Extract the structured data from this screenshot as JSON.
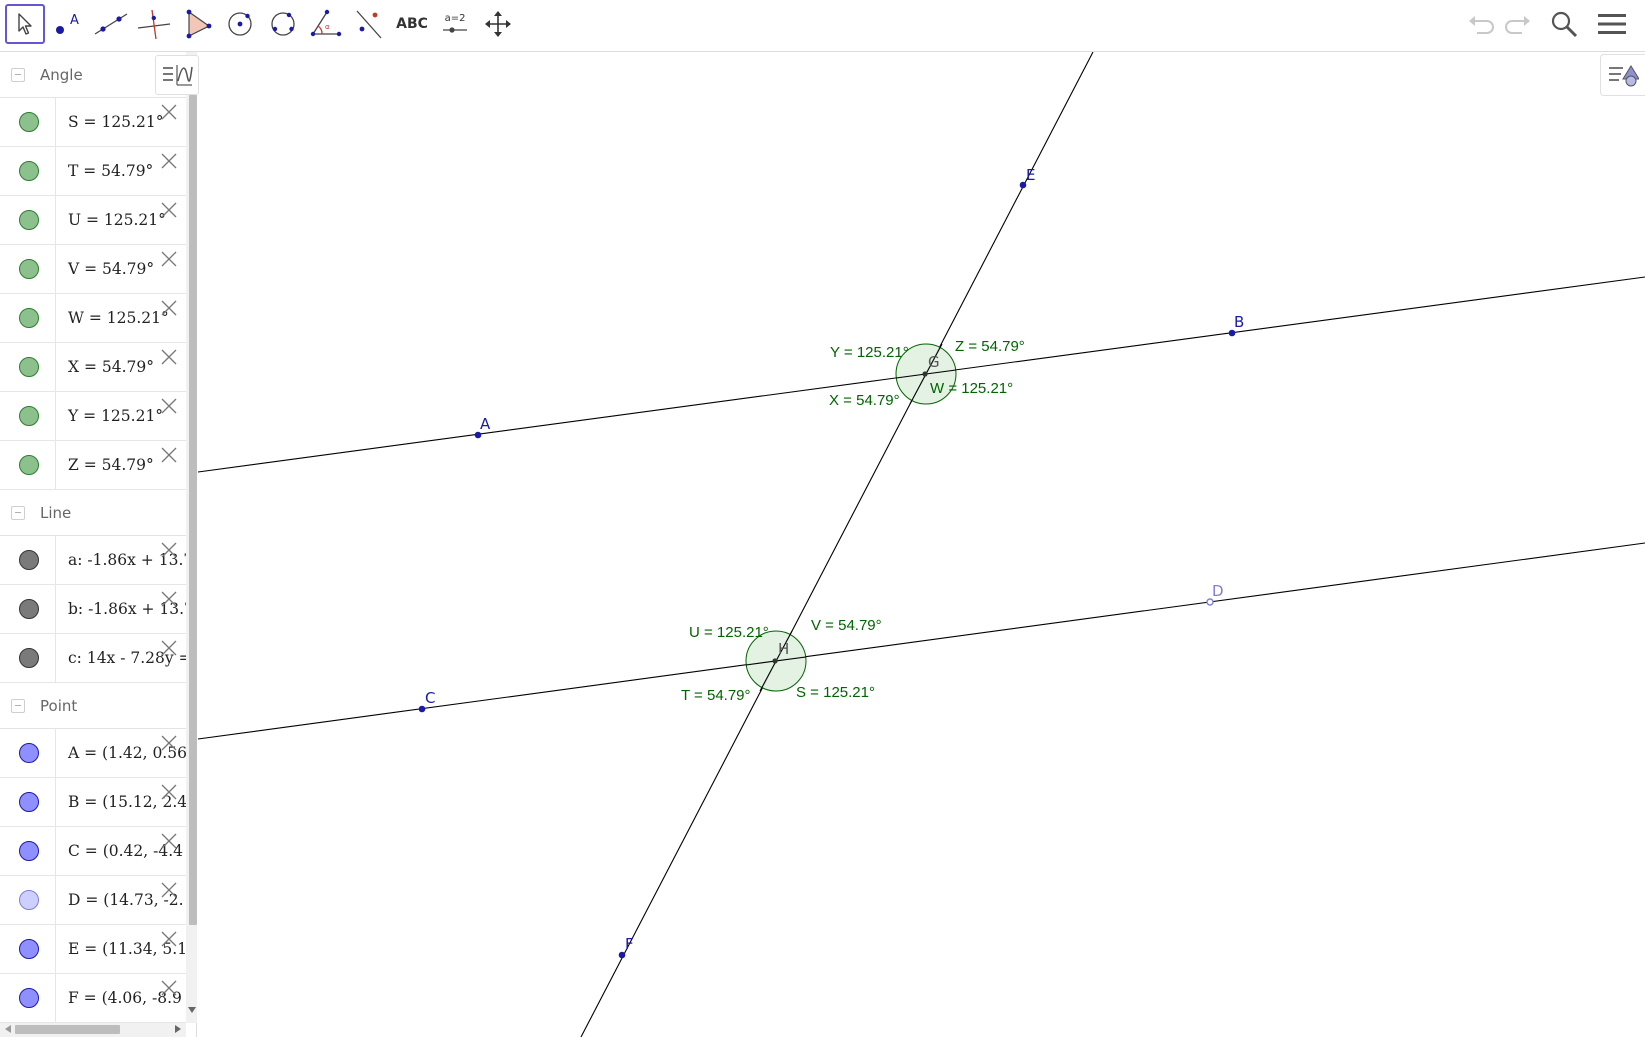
{
  "toolbar": {
    "tools": [
      {
        "name": "move-tool",
        "active": true
      },
      {
        "name": "point-tool",
        "label": "A"
      },
      {
        "name": "line-tool"
      },
      {
        "name": "perpendicular-line-tool"
      },
      {
        "name": "polygon-tool"
      },
      {
        "name": "circle-center-point-tool"
      },
      {
        "name": "circle-three-points-tool"
      },
      {
        "name": "angle-tool"
      },
      {
        "name": "reflect-about-line-tool"
      },
      {
        "name": "text-tool",
        "label": "ABC"
      },
      {
        "name": "slider-tool",
        "label": "a=2"
      },
      {
        "name": "move-graphics-view-tool"
      }
    ],
    "right_icons": [
      "undo-icon",
      "redo-icon",
      "search-icon",
      "menu-icon"
    ]
  },
  "algebra": {
    "groups": [
      {
        "title": "Angle",
        "items": [
          {
            "text": "S = 125.21°",
            "color": "#8cc08c"
          },
          {
            "text": "T = 54.79°",
            "color": "#8cc08c"
          },
          {
            "text": "U = 125.21°",
            "color": "#8cc08c"
          },
          {
            "text": "V = 54.79°",
            "color": "#8cc08c"
          },
          {
            "text": "W = 125.21°",
            "color": "#8cc08c"
          },
          {
            "text": "X = 54.79°",
            "color": "#8cc08c"
          },
          {
            "text": "Y = 125.21°",
            "color": "#8cc08c"
          },
          {
            "text": "Z = 54.79°",
            "color": "#8cc08c"
          }
        ]
      },
      {
        "title": "Line",
        "items": [
          {
            "text": "a: -1.86x + 13.7",
            "color": "#7a7a7a"
          },
          {
            "text": "b: -1.86x + 13.7",
            "color": "#7a7a7a"
          },
          {
            "text": "c: 14x - 7.28y =",
            "color": "#7a7a7a"
          }
        ]
      },
      {
        "title": "Point",
        "items": [
          {
            "text": "A = (1.42, 0.56",
            "color": "#8f8fff"
          },
          {
            "text": "B = (15.12, 2.4",
            "color": "#8f8fff"
          },
          {
            "text": "C = (0.42, -4.4",
            "color": "#8f8fff"
          },
          {
            "text": "D = (14.73, -2.",
            "color": "#cccfff"
          },
          {
            "text": "E = (11.34, 5.1",
            "color": "#8f8fff"
          },
          {
            "text": "F = (4.06, -8.9",
            "color": "#8f8fff"
          }
        ]
      }
    ]
  },
  "graphics": {
    "colors": {
      "point": "#1a1aa8",
      "point_light": "#7f7fd6",
      "angle": "#006400",
      "angle_fill": "#dff0df",
      "line": "#000000"
    },
    "points": {
      "A": "A",
      "B": "B",
      "C": "C",
      "D": "D",
      "E": "E",
      "F": "F",
      "G": "G",
      "H": "H"
    },
    "angle_labels": {
      "S": "S = 125.21°",
      "T": "T = 54.79°",
      "U": "U = 125.21°",
      "V": "V = 54.79°",
      "W": "W = 125.21°",
      "X": "X = 54.79°",
      "Y": "Y = 125.21°",
      "Z": "Z = 54.79°"
    }
  }
}
